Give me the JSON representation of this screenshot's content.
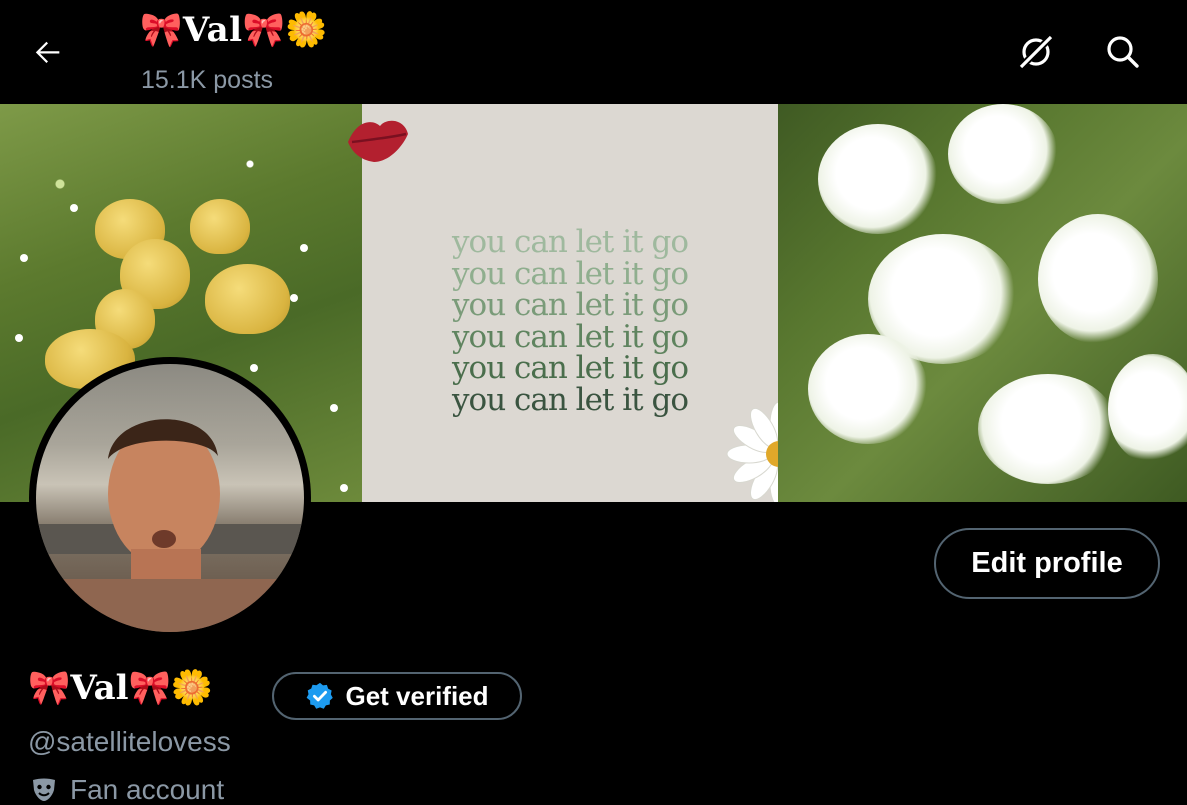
{
  "header": {
    "title": "🎀Val🎀🌼",
    "posts": "15.1K posts"
  },
  "banner": {
    "slogan_lines": [
      "you can let it go",
      "you can let it go",
      "you can let it go",
      "you can let it go",
      "you can let it go",
      "you can let it go"
    ],
    "slogan_colors": [
      "#9fb99e",
      "#8fae8e",
      "#7a9b79",
      "#5f845f",
      "#4a6e4c",
      "#3a5440"
    ]
  },
  "profile": {
    "edit_label": "Edit profile",
    "name": "🎀Val🎀🌼",
    "verify_label": "Get verified",
    "handle": "@satellitelovess",
    "category": "Fan account"
  },
  "colors": {
    "background": "#000000",
    "muted": "#8b98a5",
    "border": "#536471",
    "verified_blue": "#1d9bf0"
  },
  "icons": [
    "back-arrow-icon",
    "grok-icon",
    "search-icon",
    "verified-badge-icon",
    "theater-masks-icon"
  ]
}
